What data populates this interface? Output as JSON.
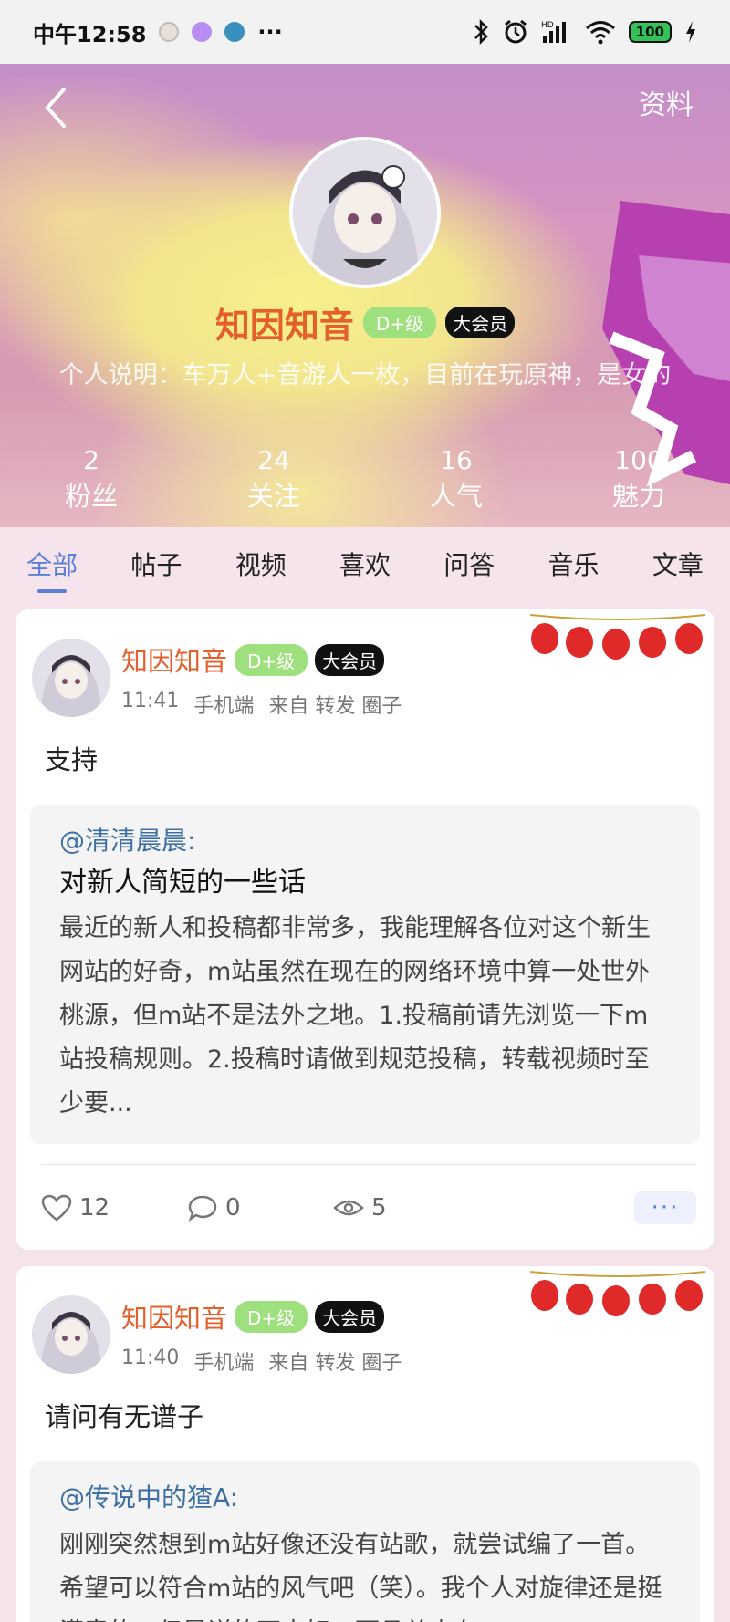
{
  "status_bar": {
    "time": "中午12:58",
    "more": "···",
    "battery": "100"
  },
  "header": {
    "back_label": "返回",
    "profile_link": "资料",
    "username": "知因知音",
    "level": "D+级",
    "vip": "大会员",
    "bio": "个人说明：车万人+音游人一枚，目前在玩原神，是女的",
    "stats": [
      {
        "num": "2",
        "label": "粉丝"
      },
      {
        "num": "24",
        "label": "关注"
      },
      {
        "num": "16",
        "label": "人气"
      },
      {
        "num": "100",
        "label": "魅力"
      }
    ]
  },
  "tabs": [
    "全部",
    "帖子",
    "视频",
    "喜欢",
    "问答",
    "音乐",
    "文章"
  ],
  "posts": [
    {
      "name": "知因知音",
      "level": "D+级",
      "vip": "大会员",
      "time": "11:41",
      "device": "手机端",
      "source": "来自 转发 圈子",
      "text": "支持",
      "quote": {
        "author": "@清清晨晨:",
        "title": "对新人简短的一些话",
        "body": "最近的新人和投稿都非常多，我能理解各位对这个新生网站的好奇，m站虽然在现在的网络环境中算一处世外桃源，但m站不是法外之地。1.投稿前请先浏览一下m站投稿规则。2.投稿时请做到规范投稿，转载视频时至少要..."
      },
      "likes": "12",
      "comments": "0",
      "views": "5",
      "more": "···"
    },
    {
      "name": "知因知音",
      "level": "D+级",
      "vip": "大会员",
      "time": "11:40",
      "device": "手机端",
      "source": "来自 转发 圈子",
      "text": "请问有无谱子",
      "quote": {
        "author": "@传说中的猹A:",
        "body": "刚刚突然想到m站好像还没有站歌，就尝试编了一首。希望可以符合m站的风气吧（笑）。我个人对旋律还是挺满意的，但是详的不太好，而且总走在"
      }
    }
  ],
  "colors": {
    "accent": "#5b7fd6",
    "username": "#e3602c",
    "level_badge": "#9fe07e",
    "vip_badge": "#111111"
  }
}
